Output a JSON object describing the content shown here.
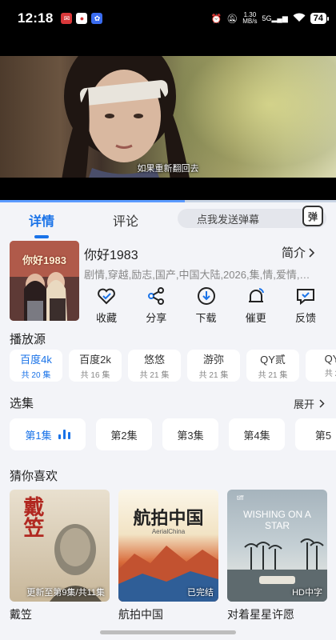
{
  "status_bar": {
    "time": "12:18",
    "speed_top": "1.30",
    "speed_bottom": "MB/s",
    "network": "5G",
    "battery": "74"
  },
  "video": {
    "subtitle": "如果重新翻回去",
    "progress": 0.55
  },
  "tabs": [
    {
      "label": "详情",
      "active": true
    },
    {
      "label": "评论",
      "active": false
    }
  ],
  "danmaku": {
    "placeholder": "点我发送弹幕",
    "button": "弹"
  },
  "show": {
    "title": "你好1983",
    "intro_label": "简介",
    "tags": "剧情,穿越,励志,国产,中国大陆,2026,集,情,爱情,…",
    "poster_text": "你好1983"
  },
  "actions": [
    {
      "label": "收藏",
      "icon": "heart-icon"
    },
    {
      "label": "分享",
      "icon": "share-icon"
    },
    {
      "label": "下载",
      "icon": "download-icon"
    },
    {
      "label": "催更",
      "icon": "bell-icon"
    },
    {
      "label": "反馈",
      "icon": "feedback-icon"
    }
  ],
  "sources_section": {
    "title": "播放源",
    "items": [
      {
        "name": "百度4k",
        "count": "共 20 集",
        "active": true
      },
      {
        "name": "百度2k",
        "count": "共 16 集",
        "active": false
      },
      {
        "name": "悠悠",
        "count": "共 21 集",
        "active": false
      },
      {
        "name": "游弥",
        "count": "共 21 集",
        "active": false
      },
      {
        "name": "QY贰",
        "count": "共 21 集",
        "active": false
      },
      {
        "name": "QY",
        "count": "共 2",
        "active": false
      }
    ]
  },
  "episodes_section": {
    "title": "选集",
    "expand_label": "展开",
    "items": [
      {
        "label": "第1集",
        "active": true
      },
      {
        "label": "第2集",
        "active": false
      },
      {
        "label": "第3集",
        "active": false
      },
      {
        "label": "第4集",
        "active": false
      },
      {
        "label": "第5",
        "active": false
      }
    ]
  },
  "recommend_section": {
    "title": "猜你喜欢",
    "items": [
      {
        "title": "戴笠",
        "badge": "更新至第9集/共11集",
        "thumb_text": "戴笠"
      },
      {
        "title": "航拍中国",
        "badge": "已完结",
        "thumb_text": "航拍中国",
        "thumb_sub": "AerialChina"
      },
      {
        "title": "对着星星许愿",
        "badge": "HD中字",
        "thumb_text": "WISHING ON A STAR",
        "thumb_sub": "tiff"
      }
    ]
  },
  "colors": {
    "accent": "#1a73e8",
    "background": "#f3f4f8"
  }
}
